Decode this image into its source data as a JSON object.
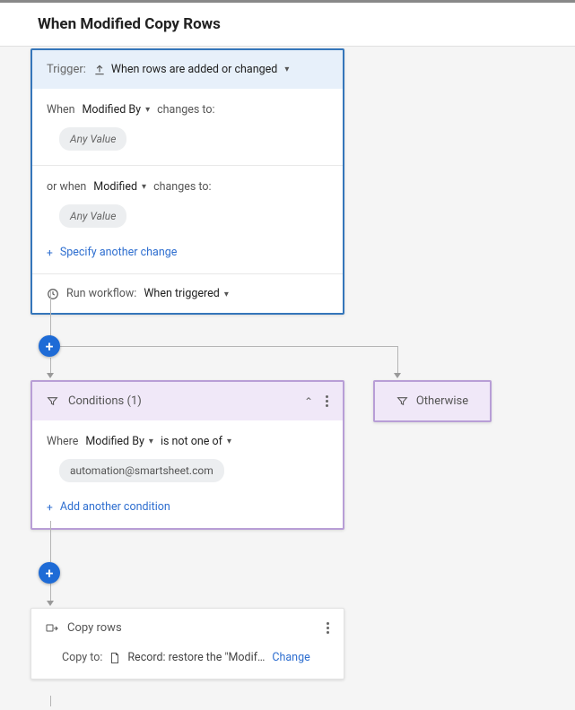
{
  "header": {
    "title": "When Modified Copy Rows"
  },
  "trigger": {
    "label": "Trigger:",
    "selection": "When rows are added or changed",
    "changes": [
      {
        "prefix": "When",
        "field": "Modified By",
        "suffix": "changes to:",
        "value": "Any Value"
      },
      {
        "prefix": "or when",
        "field": "Modified",
        "suffix": "changes to:",
        "value": "Any Value"
      }
    ],
    "specify_link": "Specify another change",
    "run_label": "Run workflow:",
    "run_value": "When triggered"
  },
  "conditions": {
    "title": "Conditions (1)",
    "where_label": "Where",
    "field": "Modified By",
    "operator": "is not one of",
    "value": "automation@smartsheet.com",
    "add_link": "Add another condition"
  },
  "otherwise": {
    "label": "Otherwise"
  },
  "action": {
    "title": "Copy rows",
    "copy_label": "Copy to:",
    "destination": "Record: restore the \"Modif…",
    "change_link": "Change"
  }
}
